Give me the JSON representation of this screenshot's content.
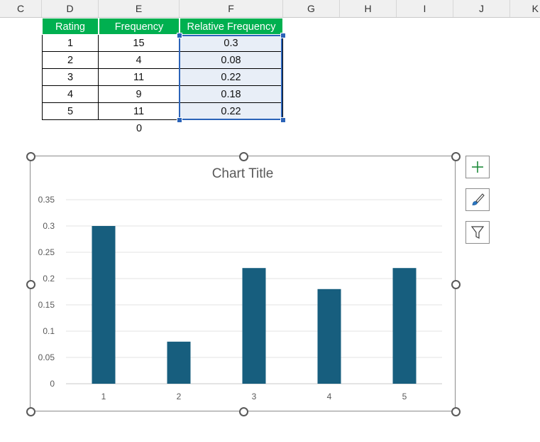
{
  "columns": [
    "C",
    "D",
    "E",
    "F",
    "G",
    "H",
    "I",
    "J",
    "K"
  ],
  "table": {
    "headers": [
      "Rating",
      "Frequency",
      "Relative Frequency"
    ],
    "rows": [
      [
        "1",
        "15",
        "0.3"
      ],
      [
        "2",
        "4",
        "0.08"
      ],
      [
        "3",
        "11",
        "0.22"
      ],
      [
        "4",
        "9",
        "0.18"
      ],
      [
        "5",
        "11",
        "0.22"
      ]
    ],
    "total": "0"
  },
  "colors": {
    "header_fill": "#00b050",
    "bar": "#175e7e",
    "selection": "#2b63b8"
  },
  "chart_data": {
    "type": "bar",
    "title": "Chart Title",
    "categories": [
      "1",
      "2",
      "3",
      "4",
      "5"
    ],
    "values": [
      0.3,
      0.08,
      0.22,
      0.18,
      0.22
    ],
    "ylim": [
      0,
      0.35
    ],
    "yticks": [
      "0",
      "0.05",
      "0.1",
      "0.15",
      "0.2",
      "0.25",
      "0.3",
      "0.35"
    ],
    "grid": true,
    "legend": "none"
  },
  "chart_tools": {
    "add_icon": "plus-icon",
    "style_icon": "paintbrush-icon",
    "filter_icon": "funnel-icon"
  }
}
